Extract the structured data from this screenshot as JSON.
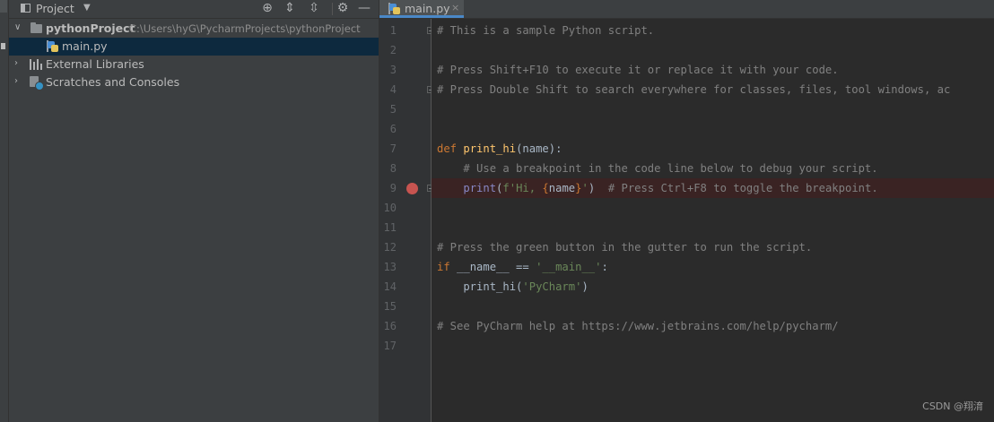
{
  "project_panel": {
    "title": "Project",
    "tree": [
      {
        "name": "pythonProject",
        "path": "C:\\Users\\hyG\\PycharmProjects\\pythonProject"
      },
      {
        "name": "main.py"
      },
      {
        "name": "External Libraries"
      },
      {
        "name": "Scratches and Consoles"
      }
    ]
  },
  "editor": {
    "tab_label": "main.py",
    "close_glyph": "×",
    "line_numbers": [
      "1",
      "2",
      "3",
      "4",
      "5",
      "6",
      "7",
      "8",
      "9",
      "10",
      "11",
      "12",
      "13",
      "14",
      "15",
      "16",
      "17"
    ],
    "breakpoint_line": 9,
    "code": {
      "l1": "# This is a sample Python script.",
      "l3": "# Press Shift+F10 to execute it or replace it with your code.",
      "l4": "# Press Double Shift to search everywhere for classes, files, tool windows, ac",
      "l7_kw": "def",
      "l7_fn": "print_hi",
      "l7_rest": "(name):",
      "l8": "    # Use a breakpoint in the code line below to debug your script.",
      "l9_indent": "    ",
      "l9_call": "print",
      "l9_paren": "(",
      "l9_str1": "f'Hi, ",
      "l9_brace1": "{",
      "l9_name": "name",
      "l9_brace2": "}",
      "l9_str2": "'",
      "l9_close": ")  ",
      "l9_comment": "# Press Ctrl+F8 to toggle the breakpoint.",
      "l12": "# Press the green button in the gutter to run the script.",
      "l13_kw": "if",
      "l13_mid": " __name__ == ",
      "l13_str": "'__main__'",
      "l13_end": ":",
      "l14_call": "    print_hi(",
      "l14_str": "'PyCharm'",
      "l14_end": ")",
      "l16": "# See PyCharm help at https://www.jetbrains.com/help/pycharm/"
    }
  },
  "watermark": "CSDN @翔淯",
  "colors": {
    "breakpoint": "#c75450",
    "selection": "#0d293e",
    "keyword": "#cc7832",
    "string": "#6a8759",
    "comment": "#808080"
  },
  "icons": [
    "folder-icon",
    "python-file-icon",
    "library-icon",
    "scratch-icon",
    "locate-icon",
    "expand-all-icon",
    "collapse-all-icon",
    "gear-icon",
    "minimize-icon",
    "breakpoint-icon"
  ]
}
